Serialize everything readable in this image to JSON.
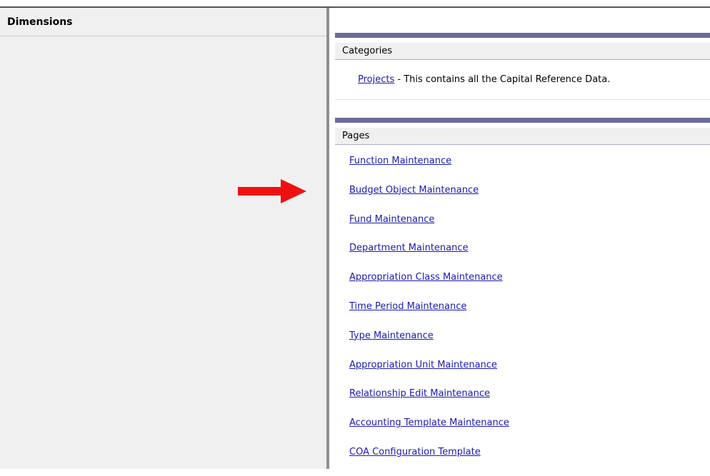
{
  "left_panel": {
    "title": "Dimensions"
  },
  "categories": {
    "header": "Categories",
    "items": [
      {
        "link_label": "Projects",
        "description": " - This contains all the Capital Reference Data."
      }
    ]
  },
  "pages": {
    "header": "Pages",
    "items": [
      "Function Maintenance",
      "Budget Object Maintenance",
      "Fund Maintenance",
      "Department Maintenance",
      "Appropriation Class Maintenance",
      "Time Period Maintenance",
      "Type Maintenance",
      "Appropriation Unit Maintenance",
      "Relationship Edit Maintenance",
      "Accounting Template Maintenance",
      "COA Configuration Template"
    ]
  },
  "annotation": {
    "arrow_icon": "right-arrow-icon",
    "arrow_color": "#ee1111",
    "points_to": "Budget Object Maintenance"
  },
  "colors": {
    "section_bar": "#6b6b99",
    "link": "#1a1ab0",
    "panel_bg": "#f0f0f0"
  }
}
